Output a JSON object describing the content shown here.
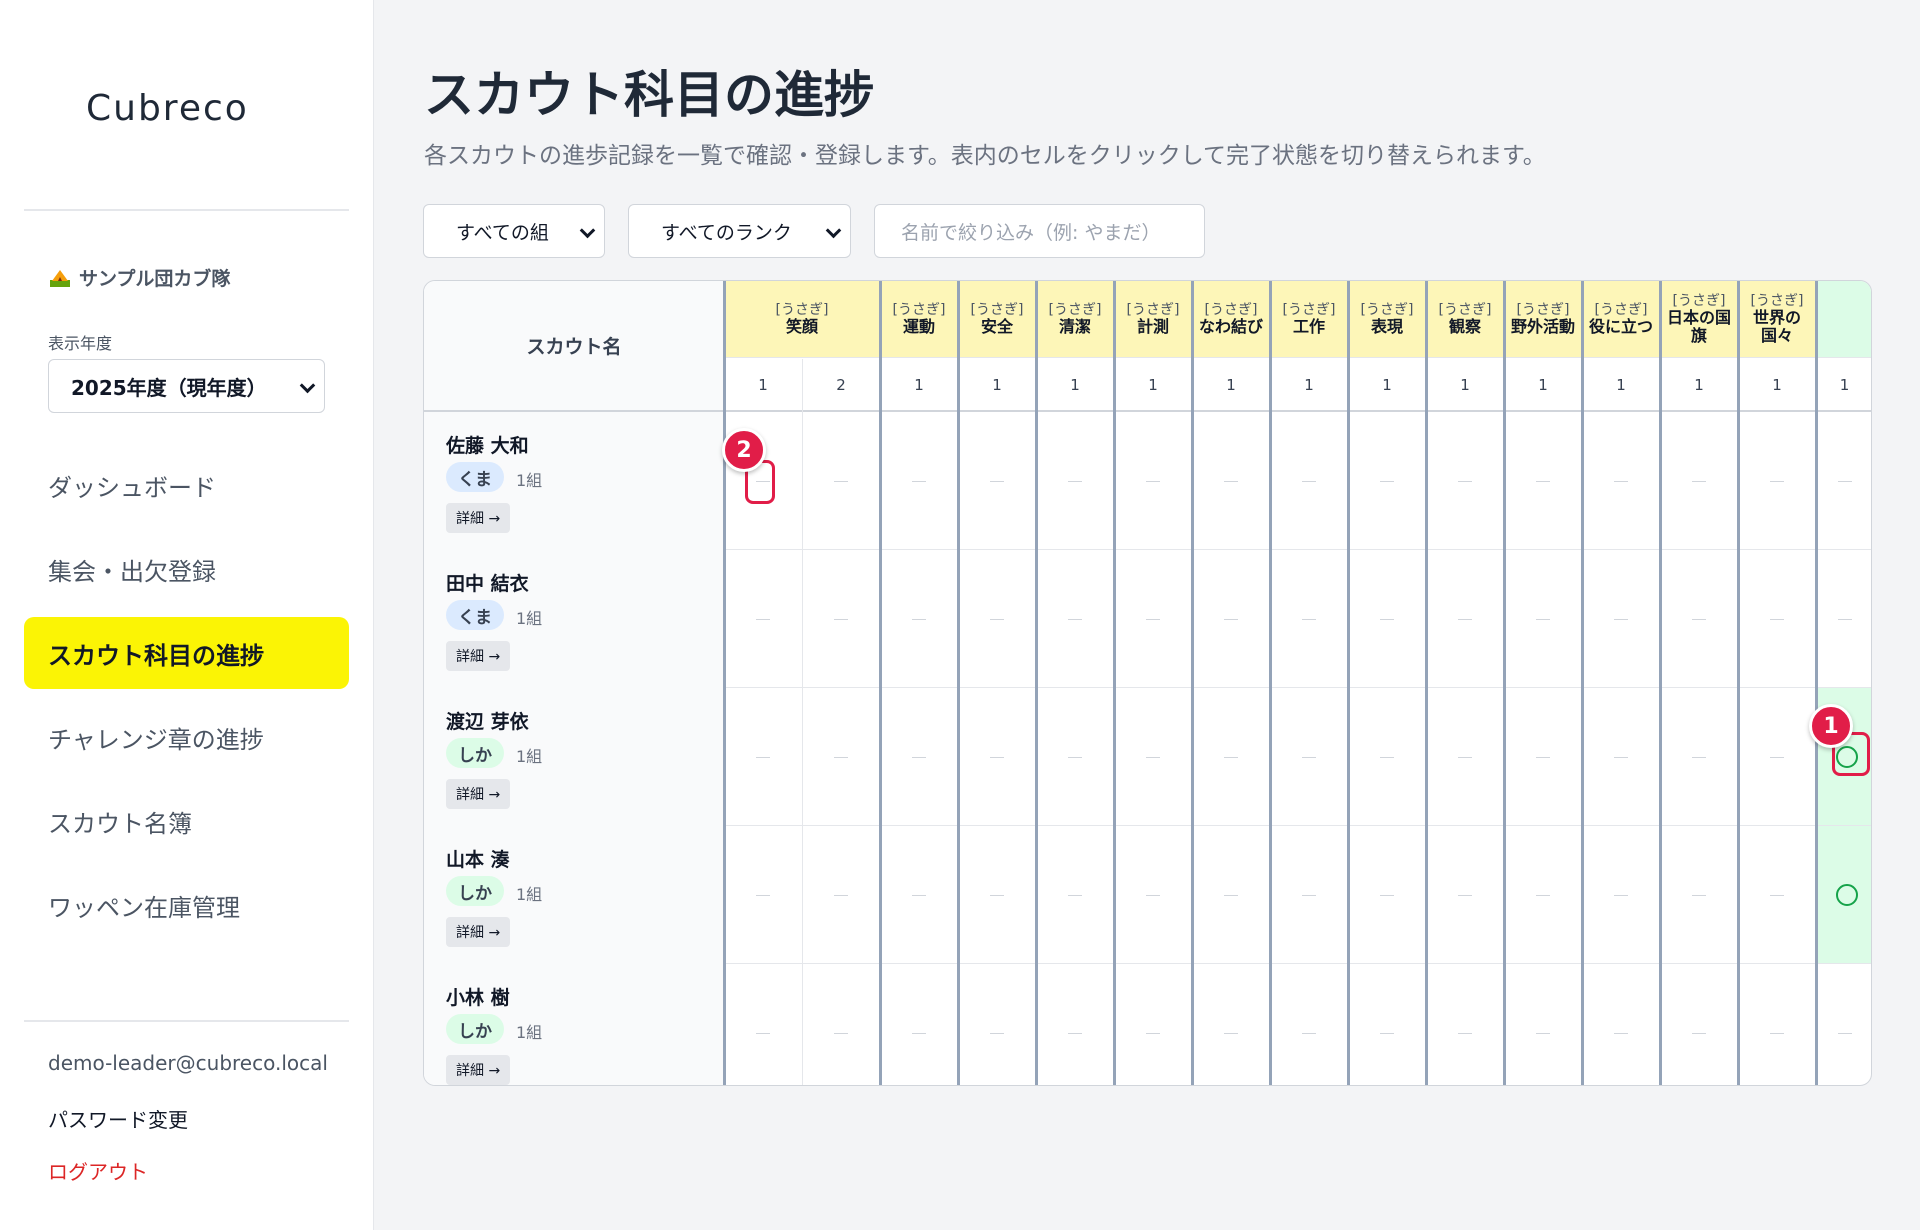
{
  "sidebar": {
    "logo": "Cubreco",
    "group_name": "サンプル団カブ隊",
    "year_label": "表示年度",
    "year_value": "2025年度（現年度）",
    "nav": [
      {
        "label": "ダッシュボード",
        "active": false
      },
      {
        "label": "集会・出欠登録",
        "active": false
      },
      {
        "label": "スカウト科目の進捗",
        "active": true
      },
      {
        "label": "チャレンジ章の進捗",
        "active": false
      },
      {
        "label": "スカウト名簿",
        "active": false
      },
      {
        "label": "ワッペン在庫管理",
        "active": false
      }
    ],
    "email": "demo-leader@cubreco.local",
    "password_change": "パスワード変更",
    "logout": "ログアウト"
  },
  "main": {
    "title": "スカウト科目の進捗",
    "subtitle": "各スカウトの進歩記録を一覧で確認・登録します。表内のセルをクリックして完了状態を切り替えられます。",
    "filters": {
      "group": "すべての組",
      "rank": "すべてのランク",
      "name_placeholder": "名前で絞り込み（例: やまだ）"
    },
    "table": {
      "name_header": "スカウト名",
      "subjects": [
        {
          "rank": "[うさぎ]",
          "name": "笑顔",
          "items": [
            "1",
            "2"
          ]
        },
        {
          "rank": "[うさぎ]",
          "name": "運動",
          "items": [
            "1"
          ]
        },
        {
          "rank": "[うさぎ]",
          "name": "安全",
          "items": [
            "1"
          ]
        },
        {
          "rank": "[うさぎ]",
          "name": "清潔",
          "items": [
            "1"
          ]
        },
        {
          "rank": "[うさぎ]",
          "name": "計測",
          "items": [
            "1"
          ]
        },
        {
          "rank": "[うさぎ]",
          "name": "なわ結び",
          "items": [
            "1"
          ]
        },
        {
          "rank": "[うさぎ]",
          "name": "工作",
          "items": [
            "1"
          ]
        },
        {
          "rank": "[うさぎ]",
          "name": "表現",
          "items": [
            "1"
          ]
        },
        {
          "rank": "[うさぎ]",
          "name": "観察",
          "items": [
            "1"
          ]
        },
        {
          "rank": "[うさぎ]",
          "name": "野外活動",
          "items": [
            "1"
          ]
        },
        {
          "rank": "[うさぎ]",
          "name": "役に立つ",
          "items": [
            "1"
          ]
        },
        {
          "rank": "[うさぎ]",
          "name": "日本の国旗",
          "items": [
            "1"
          ]
        },
        {
          "rank": "[うさぎ]",
          "name": "世界の国々",
          "items": [
            "1"
          ]
        },
        {
          "rank": "",
          "name": "",
          "items": [
            "1"
          ]
        }
      ],
      "scouts": [
        {
          "name": "佐藤 大和",
          "rank": "くま",
          "group": "1組",
          "detail": "詳細 →"
        },
        {
          "name": "田中 結衣",
          "rank": "くま",
          "group": "1組",
          "detail": "詳細 →"
        },
        {
          "name": "渡辺 芽依",
          "rank": "しか",
          "group": "1組",
          "detail": "詳細 →"
        },
        {
          "name": "山本 湊",
          "rank": "しか",
          "group": "1組",
          "detail": "詳細 →"
        },
        {
          "name": "小林 樹",
          "rank": "しか",
          "group": "1組",
          "detail": "詳細 →"
        }
      ]
    },
    "markers": [
      "1",
      "2"
    ]
  }
}
